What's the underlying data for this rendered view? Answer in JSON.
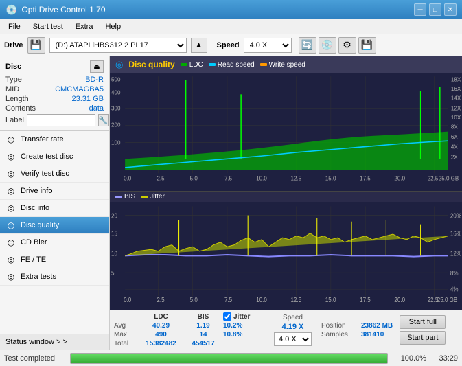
{
  "titleBar": {
    "title": "Opti Drive Control 1.70",
    "minBtn": "─",
    "maxBtn": "□",
    "closeBtn": "✕"
  },
  "menuBar": {
    "items": [
      "File",
      "Start test",
      "Extra",
      "Help"
    ]
  },
  "driveBar": {
    "label": "Drive",
    "driveValue": "(D:) ATAPI iHBS312  2 PL17",
    "speedLabel": "Speed",
    "speedValue": "4.0 X"
  },
  "disc": {
    "title": "Disc",
    "typeLabel": "Type",
    "typeValue": "BD-R",
    "midLabel": "MID",
    "midValue": "CMCMAGBA5",
    "lengthLabel": "Length",
    "lengthValue": "23.31 GB",
    "contentsLabel": "Contents",
    "contentsValue": "data",
    "labelLabel": "Label",
    "labelValue": ""
  },
  "navItems": [
    {
      "id": "transfer-rate",
      "label": "Transfer rate",
      "icon": "◎"
    },
    {
      "id": "create-test-disc",
      "label": "Create test disc",
      "icon": "◎"
    },
    {
      "id": "verify-test-disc",
      "label": "Verify test disc",
      "icon": "◎"
    },
    {
      "id": "drive-info",
      "label": "Drive info",
      "icon": "◎"
    },
    {
      "id": "disc-info",
      "label": "Disc info",
      "icon": "◎"
    },
    {
      "id": "disc-quality",
      "label": "Disc quality",
      "icon": "◎",
      "active": true
    },
    {
      "id": "cd-bler",
      "label": "CD Bler",
      "icon": "◎"
    },
    {
      "id": "fe-te",
      "label": "FE / TE",
      "icon": "◎"
    },
    {
      "id": "extra-tests",
      "label": "Extra tests",
      "icon": "◎"
    }
  ],
  "statusWindowBtn": "Status window > >",
  "discQualityTitle": "Disc quality",
  "legend": {
    "ldc": "LDC",
    "readSpeed": "Read speed",
    "writeSpeed": "Write speed",
    "bis": "BIS",
    "jitter": "Jitter"
  },
  "stats": {
    "ldcHeader": "LDC",
    "bisHeader": "BIS",
    "jitterHeader": "Jitter",
    "avgLabel": "Avg",
    "maxLabel": "Max",
    "totalLabel": "Total",
    "ldcAvg": "40.29",
    "ldcMax": "490",
    "ldcTotal": "15382482",
    "bisAvg": "1.19",
    "bisMax": "14",
    "bisTotal": "454517",
    "jitterAvg": "10.2%",
    "jitterMax": "10.8%",
    "jitterTotal": "",
    "speedLabel": "Speed",
    "speedVal": "4.19 X",
    "speedOption": "4.0 X",
    "positionLabel": "Position",
    "positionVal": "23862 MB",
    "samplesLabel": "Samples",
    "samplesVal": "381410",
    "startFullBtn": "Start full",
    "startPartBtn": "Start part"
  },
  "statusBar": {
    "text": "Test completed",
    "progressPct": "100.0%",
    "progressTime": "33:29",
    "progressWidth": 100
  }
}
